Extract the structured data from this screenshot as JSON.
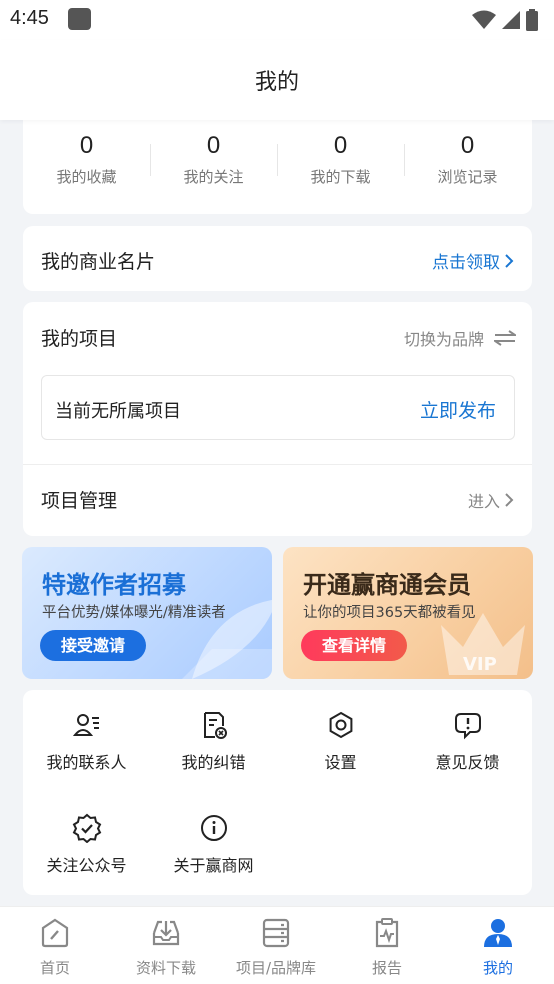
{
  "status_bar": {
    "time": "4:45"
  },
  "header": {
    "title": "我的"
  },
  "stats": [
    {
      "value": "0",
      "label": "我的收藏"
    },
    {
      "value": "0",
      "label": "我的关注"
    },
    {
      "value": "0",
      "label": "我的下载"
    },
    {
      "value": "0",
      "label": "浏览记录"
    }
  ],
  "business_card": {
    "title": "我的商业名片",
    "action": "点击领取"
  },
  "project": {
    "title": "我的项目",
    "switch_label": "切换为品牌",
    "empty_text": "当前无所属项目",
    "publish_label": "立即发布",
    "management_label": "项目管理",
    "enter_label": "进入"
  },
  "banners": {
    "author": {
      "title": "特邀作者招募",
      "subtitle": "平台优势/媒体曝光/精准读者",
      "button": "接受邀请"
    },
    "member": {
      "title": "开通赢商通会员",
      "subtitle": "让你的项目365天都被看见",
      "button": "查看详情",
      "badge": "VIP"
    }
  },
  "tools": [
    {
      "label": "我的联系人",
      "icon": "contacts-icon"
    },
    {
      "label": "我的纠错",
      "icon": "correction-icon"
    },
    {
      "label": "设置",
      "icon": "settings-icon"
    },
    {
      "label": "意见反馈",
      "icon": "feedback-icon"
    },
    {
      "label": "关注公众号",
      "icon": "verified-badge-icon"
    },
    {
      "label": "关于赢商网",
      "icon": "info-icon"
    }
  ],
  "tabs": [
    {
      "label": "首页",
      "icon": "home-icon",
      "active": false
    },
    {
      "label": "资料下载",
      "icon": "download-icon",
      "active": false
    },
    {
      "label": "项目/品牌库",
      "icon": "database-icon",
      "active": false
    },
    {
      "label": "报告",
      "icon": "report-icon",
      "active": false
    },
    {
      "label": "我的",
      "icon": "user-icon",
      "active": true
    }
  ],
  "colors": {
    "accent": "#1c6fe0",
    "link": "#1976d2",
    "background": "#f2f4f7"
  }
}
